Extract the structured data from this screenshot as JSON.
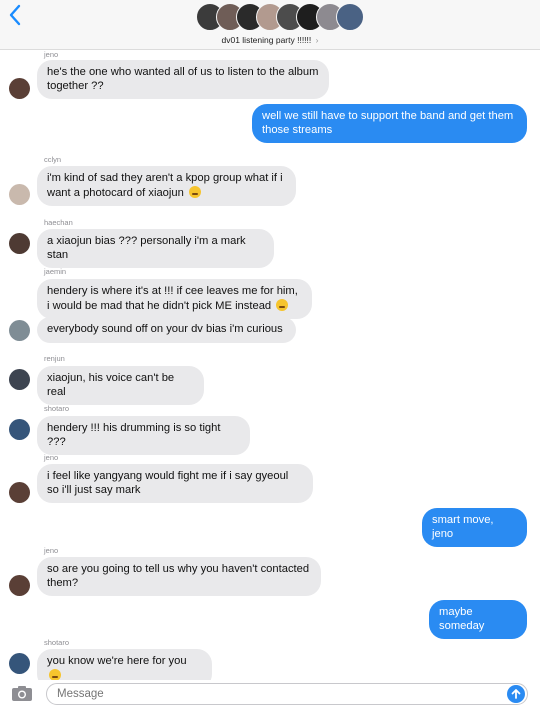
{
  "header": {
    "group_name": "dv01 listening party !!!!!!",
    "chevron": "›",
    "avatar_colors": [
      "#3b3b3b",
      "#6f5d57",
      "#2a2a2a",
      "#b29a8f",
      "#4c4c4c",
      "#1e1e1e",
      "#8d8a90",
      "#4a6284"
    ]
  },
  "messages": [
    {
      "sender": "jeno",
      "text": "he's the one who wanted all of us to listen to the album together ??",
      "avatar_color": "#5a3f36"
    },
    {
      "text": "well we still have to support the band and get them those streams"
    },
    {
      "sender": "cclyn",
      "text": "i'm kind of sad they aren't a kpop group what if i want a photocard of xiaojun",
      "avatar_color": "#c9b9ad"
    },
    {
      "sender": "haechan",
      "text": "a xiaojun bias ??? personally i'm a mark stan",
      "avatar_color": "#4e3a33"
    },
    {
      "sender": "jaemin",
      "text": "hendery is where it's at !!! if cee leaves me for him, i would be mad that he didn't pick ME instead"
    },
    {
      "text": "everybody sound off on your dv bias i'm curious",
      "avatar_color": "#7f8d95"
    },
    {
      "sender": "renjun",
      "text": "xiaojun, his voice can't be real",
      "avatar_color": "#3d4450"
    },
    {
      "sender": "shotaro",
      "text": "hendery !!! his drumming is so tight ???",
      "avatar_color": "#35557a"
    },
    {
      "sender": "jeno",
      "text": "i feel like yangyang would fight me if i say gyeoul so i'll just say mark",
      "avatar_color": "#5a3f36"
    },
    {
      "text": "smart move, jeno"
    },
    {
      "sender": "jeno",
      "text": "so are you going to tell us why you haven't contacted them?",
      "avatar_color": "#5a3f36"
    },
    {
      "text": "maybe someday"
    },
    {
      "sender": "shotaro",
      "text": "you know we're here for you",
      "avatar_color": "#35557a"
    }
  ],
  "composer": {
    "placeholder": "Message"
  },
  "colors": {
    "accent": "#2a8bf2",
    "incoming_bubble": "#e9e9eb"
  }
}
